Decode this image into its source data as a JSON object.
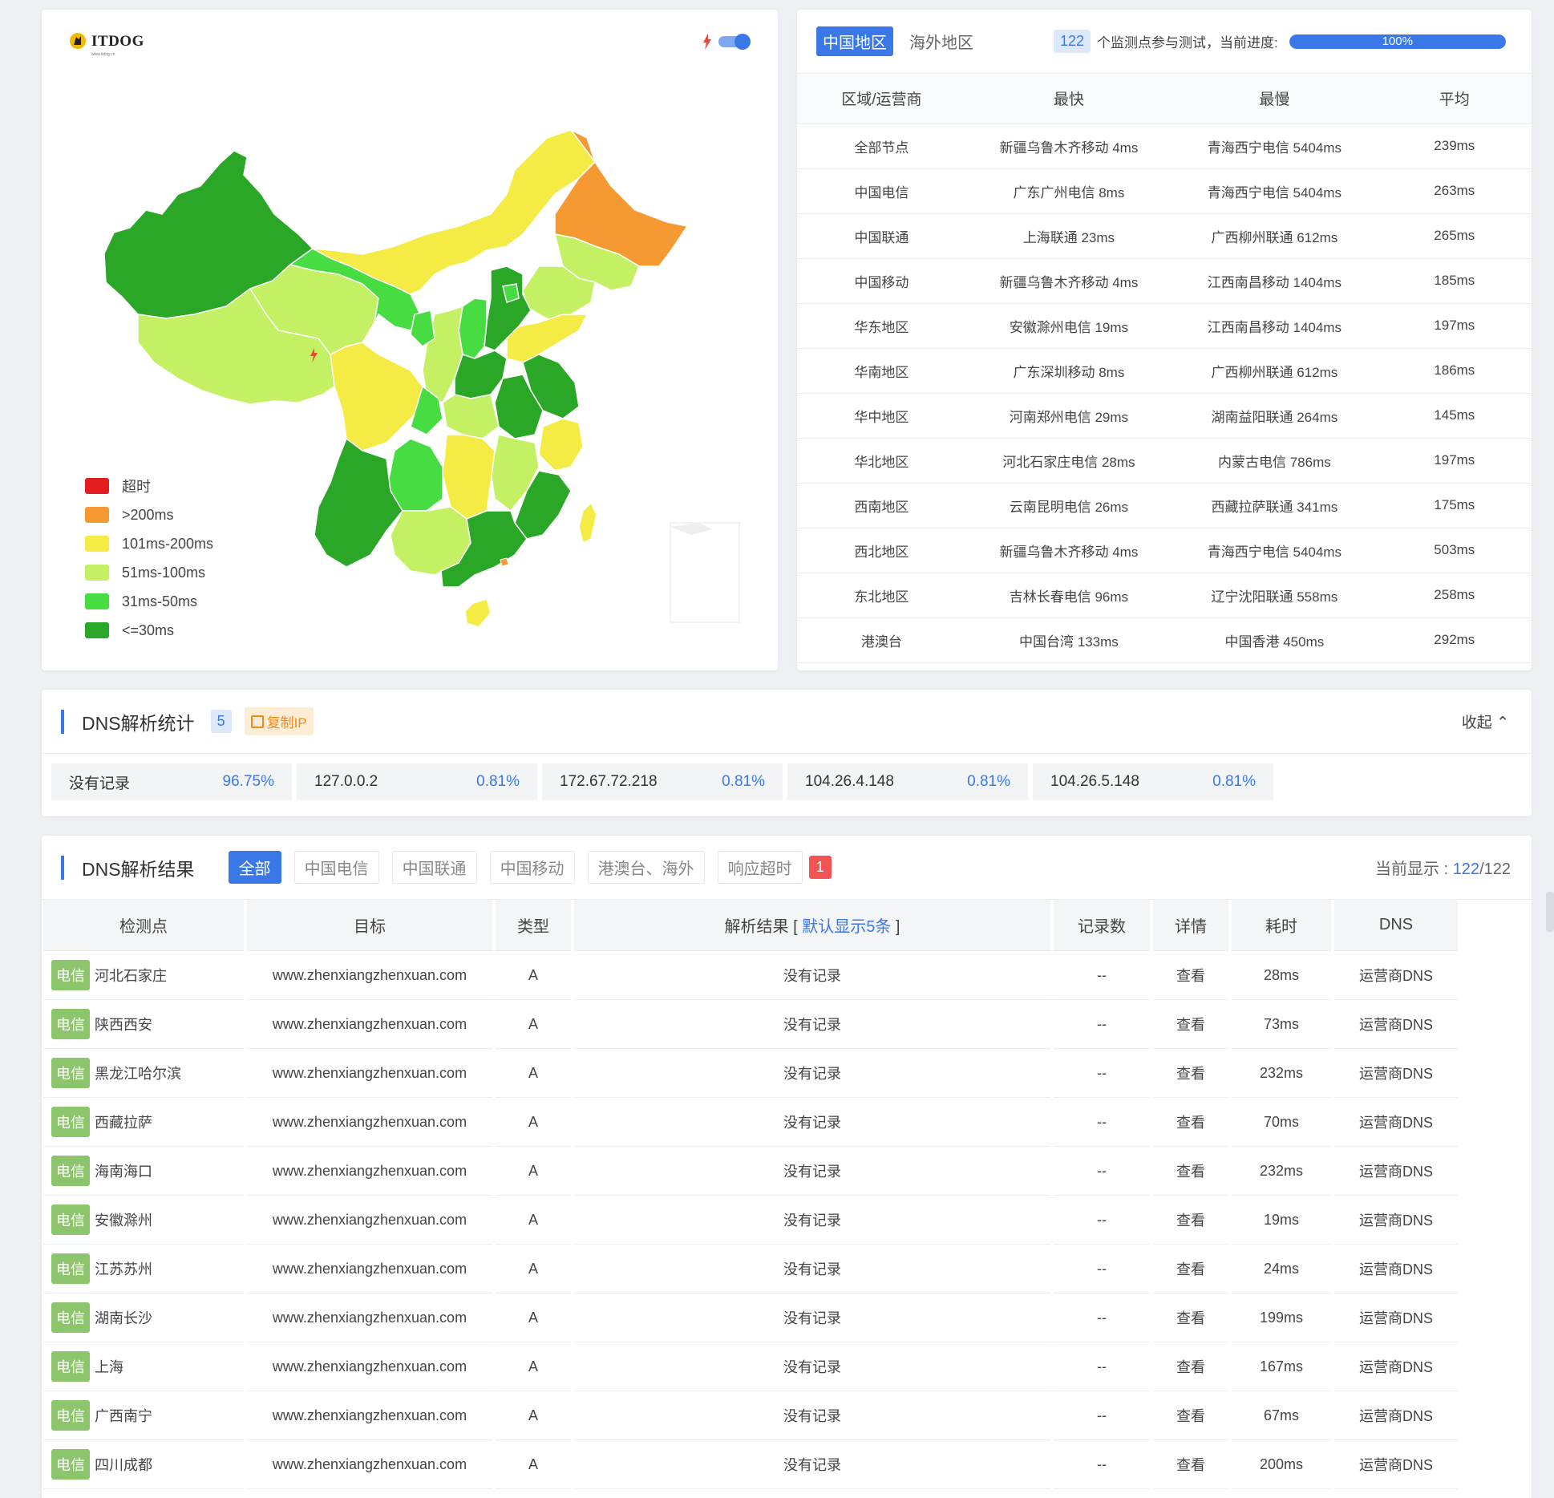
{
  "map_panel": {
    "logo_text": "ITDOG",
    "logo_sub": "www.itdog.cn",
    "legend": [
      {
        "label": "超时",
        "color": "#e11d1d"
      },
      {
        "label": ">200ms",
        "color": "#f59a33"
      },
      {
        "label": "101ms-200ms",
        "color": "#f5eb45"
      },
      {
        "label": "51ms-100ms",
        "color": "#c3f163"
      },
      {
        "label": "31ms-50ms",
        "color": "#47dd42"
      },
      {
        "label": "<=30ms",
        "color": "#2aa726"
      }
    ]
  },
  "stats_panel": {
    "tabs": [
      "中国地区",
      "海外地区"
    ],
    "node_count": "122",
    "count_text": "个监测点参与测试，当前进度:",
    "progress_value": 100,
    "progress_label": "100%",
    "columns": [
      "区域/运营商",
      "最快",
      "最慢",
      "平均"
    ],
    "rows": [
      [
        "全部节点",
        "新疆乌鲁木齐移动 4ms",
        "青海西宁电信 5404ms",
        "239ms"
      ],
      [
        "中国电信",
        "广东广州电信 8ms",
        "青海西宁电信 5404ms",
        "263ms"
      ],
      [
        "中国联通",
        "上海联通 23ms",
        "广西柳州联通 612ms",
        "265ms"
      ],
      [
        "中国移动",
        "新疆乌鲁木齐移动 4ms",
        "江西南昌移动 1404ms",
        "185ms"
      ],
      [
        "华东地区",
        "安徽滁州电信 19ms",
        "江西南昌移动 1404ms",
        "197ms"
      ],
      [
        "华南地区",
        "广东深圳移动 8ms",
        "广西柳州联通 612ms",
        "186ms"
      ],
      [
        "华中地区",
        "河南郑州电信 29ms",
        "湖南益阳联通 264ms",
        "145ms"
      ],
      [
        "华北地区",
        "河北石家庄电信 28ms",
        "内蒙古电信 786ms",
        "197ms"
      ],
      [
        "西南地区",
        "云南昆明电信 26ms",
        "西藏拉萨联通 341ms",
        "175ms"
      ],
      [
        "西北地区",
        "新疆乌鲁木齐移动 4ms",
        "青海西宁电信 5404ms",
        "503ms"
      ],
      [
        "东北地区",
        "吉林长春电信 96ms",
        "辽宁沈阳联通 558ms",
        "258ms"
      ],
      [
        "港澳台",
        "中国台湾 133ms",
        "中国香港 450ms",
        "292ms"
      ]
    ]
  },
  "dns_stats": {
    "title": "DNS解析统计",
    "count": "5",
    "copy_label": "复制IP",
    "collapse_label": "收起",
    "items": [
      {
        "name": "没有记录",
        "pct": "96.75%"
      },
      {
        "name": "127.0.0.2",
        "pct": "0.81%"
      },
      {
        "name": "172.67.72.218",
        "pct": "0.81%"
      },
      {
        "name": "104.26.4.148",
        "pct": "0.81%"
      },
      {
        "name": "104.26.5.148",
        "pct": "0.81%"
      }
    ]
  },
  "dns_results": {
    "title": "DNS解析结果",
    "tabs": [
      "全部",
      "中国电信",
      "中国联通",
      "中国移动",
      "港澳台、海外",
      "响应超时"
    ],
    "timeout_count": "1",
    "current_label": "当前显示 :",
    "current_shown": "122",
    "current_total": "/122",
    "columns": {
      "node": "检测点",
      "target": "目标",
      "type": "类型",
      "result": "解析结果",
      "result_hint_open": "[",
      "result_hint": "默认显示5条",
      "result_hint_close": "]",
      "records": "记录数",
      "detail": "详情",
      "time": "耗时",
      "dns": "DNS"
    },
    "rows": [
      {
        "isp": "电信",
        "location": "河北石家庄",
        "target": "www.zhenxiangzhenxuan.com",
        "type": "A",
        "result": "没有记录",
        "records": "--",
        "detail": "查看",
        "time": "28ms",
        "dns": "运营商DNS"
      },
      {
        "isp": "电信",
        "location": "陕西西安",
        "target": "www.zhenxiangzhenxuan.com",
        "type": "A",
        "result": "没有记录",
        "records": "--",
        "detail": "查看",
        "time": "73ms",
        "dns": "运营商DNS"
      },
      {
        "isp": "电信",
        "location": "黑龙江哈尔滨",
        "target": "www.zhenxiangzhenxuan.com",
        "type": "A",
        "result": "没有记录",
        "records": "--",
        "detail": "查看",
        "time": "232ms",
        "dns": "运营商DNS"
      },
      {
        "isp": "电信",
        "location": "西藏拉萨",
        "target": "www.zhenxiangzhenxuan.com",
        "type": "A",
        "result": "没有记录",
        "records": "--",
        "detail": "查看",
        "time": "70ms",
        "dns": "运营商DNS"
      },
      {
        "isp": "电信",
        "location": "海南海口",
        "target": "www.zhenxiangzhenxuan.com",
        "type": "A",
        "result": "没有记录",
        "records": "--",
        "detail": "查看",
        "time": "232ms",
        "dns": "运营商DNS"
      },
      {
        "isp": "电信",
        "location": "安徽滁州",
        "target": "www.zhenxiangzhenxuan.com",
        "type": "A",
        "result": "没有记录",
        "records": "--",
        "detail": "查看",
        "time": "19ms",
        "dns": "运营商DNS"
      },
      {
        "isp": "电信",
        "location": "江苏苏州",
        "target": "www.zhenxiangzhenxuan.com",
        "type": "A",
        "result": "没有记录",
        "records": "--",
        "detail": "查看",
        "time": "24ms",
        "dns": "运营商DNS"
      },
      {
        "isp": "电信",
        "location": "湖南长沙",
        "target": "www.zhenxiangzhenxuan.com",
        "type": "A",
        "result": "没有记录",
        "records": "--",
        "detail": "查看",
        "time": "199ms",
        "dns": "运营商DNS"
      },
      {
        "isp": "电信",
        "location": "上海",
        "target": "www.zhenxiangzhenxuan.com",
        "type": "A",
        "result": "没有记录",
        "records": "--",
        "detail": "查看",
        "time": "167ms",
        "dns": "运营商DNS"
      },
      {
        "isp": "电信",
        "location": "广西南宁",
        "target": "www.zhenxiangzhenxuan.com",
        "type": "A",
        "result": "没有记录",
        "records": "--",
        "detail": "查看",
        "time": "67ms",
        "dns": "运营商DNS"
      },
      {
        "isp": "电信",
        "location": "四川成都",
        "target": "www.zhenxiangzhenxuan.com",
        "type": "A",
        "result": "没有记录",
        "records": "--",
        "detail": "查看",
        "time": "200ms",
        "dns": "运营商DNS"
      }
    ]
  }
}
